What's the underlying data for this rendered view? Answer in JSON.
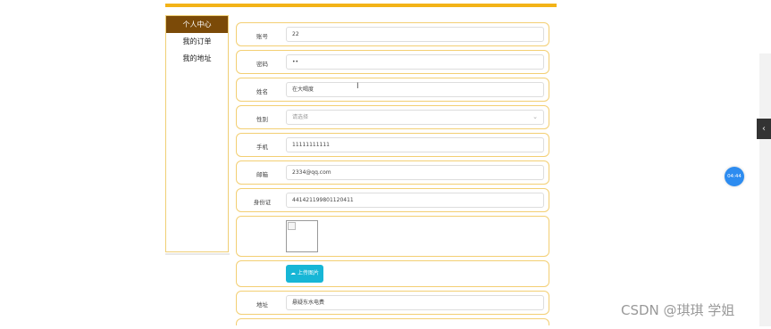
{
  "sidebar": {
    "items": [
      {
        "label": "个人中心"
      },
      {
        "label": "我的订单"
      },
      {
        "label": "我的地址"
      }
    ]
  },
  "form": {
    "fields": [
      {
        "label": "账号",
        "value": "22"
      },
      {
        "label": "密码",
        "value": "••"
      },
      {
        "label": "姓名",
        "value": "在大喝度"
      },
      {
        "label": "性别",
        "placeholder": "请选择"
      },
      {
        "label": "手机",
        "value": "11111111111"
      },
      {
        "label": "邮箱",
        "value": "2334@qq.com"
      },
      {
        "label": "身份证",
        "value": "441421199801120411"
      },
      {
        "label": "地址",
        "value": "悬疑东水电费"
      }
    ],
    "upload_label": "上传图片"
  },
  "overlay": {
    "time_badge": "04:44",
    "watermark": "CSDN @琪琪 学姐",
    "side_tab": "‹"
  },
  "colors": {
    "accent": "#f3b317",
    "sidebar_active": "#7b4a08",
    "upload_button": "#17b6d6"
  }
}
